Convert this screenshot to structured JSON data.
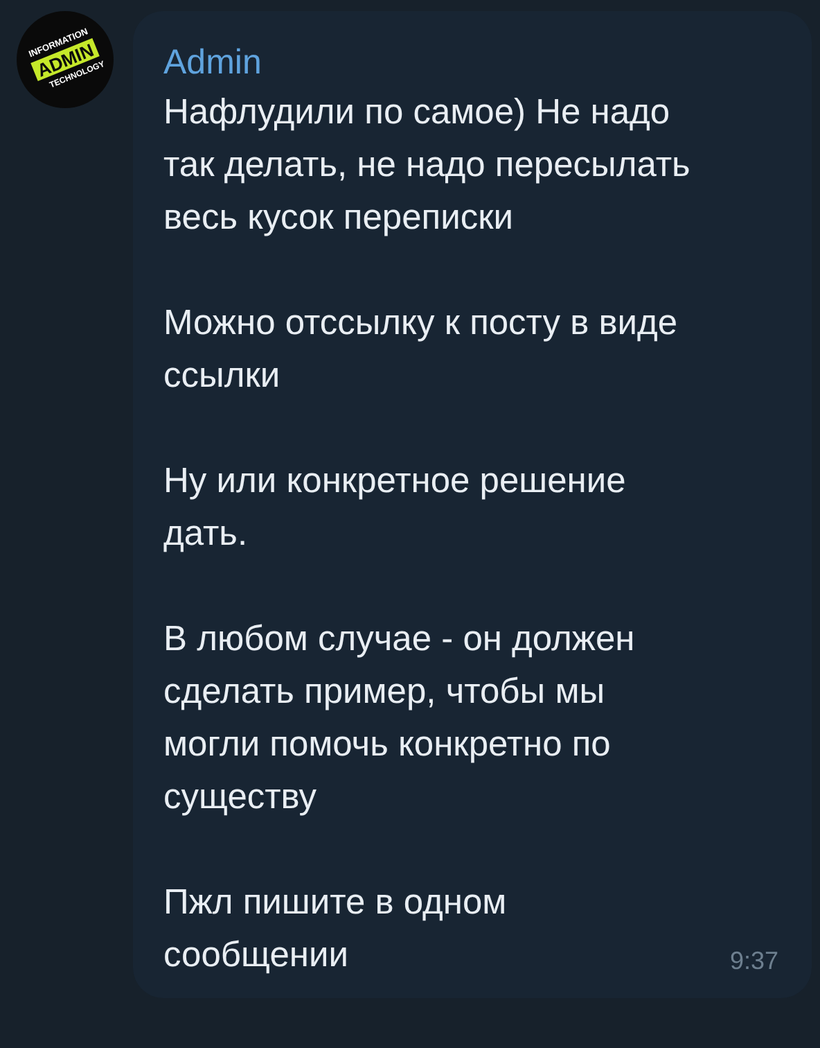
{
  "avatar": {
    "top_text": "INFORMATION",
    "middle_text": "ADMIN",
    "bottom_text": "TECHNOLOGY"
  },
  "message": {
    "sender": "Admin",
    "paragraphs": [
      [
        "Нафлудили по самое) Не надо",
        "так делать, не надо пересылать",
        "весь кусок переписки"
      ],
      [
        "Можно отссылку к посту в виде",
        "ссылки"
      ],
      [
        "Ну или конкретное решение",
        "дать."
      ],
      [
        "В любом случае - он должен",
        "сделать пример, чтобы мы",
        "могли помочь конкретно по",
        "существу"
      ],
      [
        "Пжл пишите в одном",
        "сообщении"
      ]
    ],
    "time": "9:37"
  }
}
